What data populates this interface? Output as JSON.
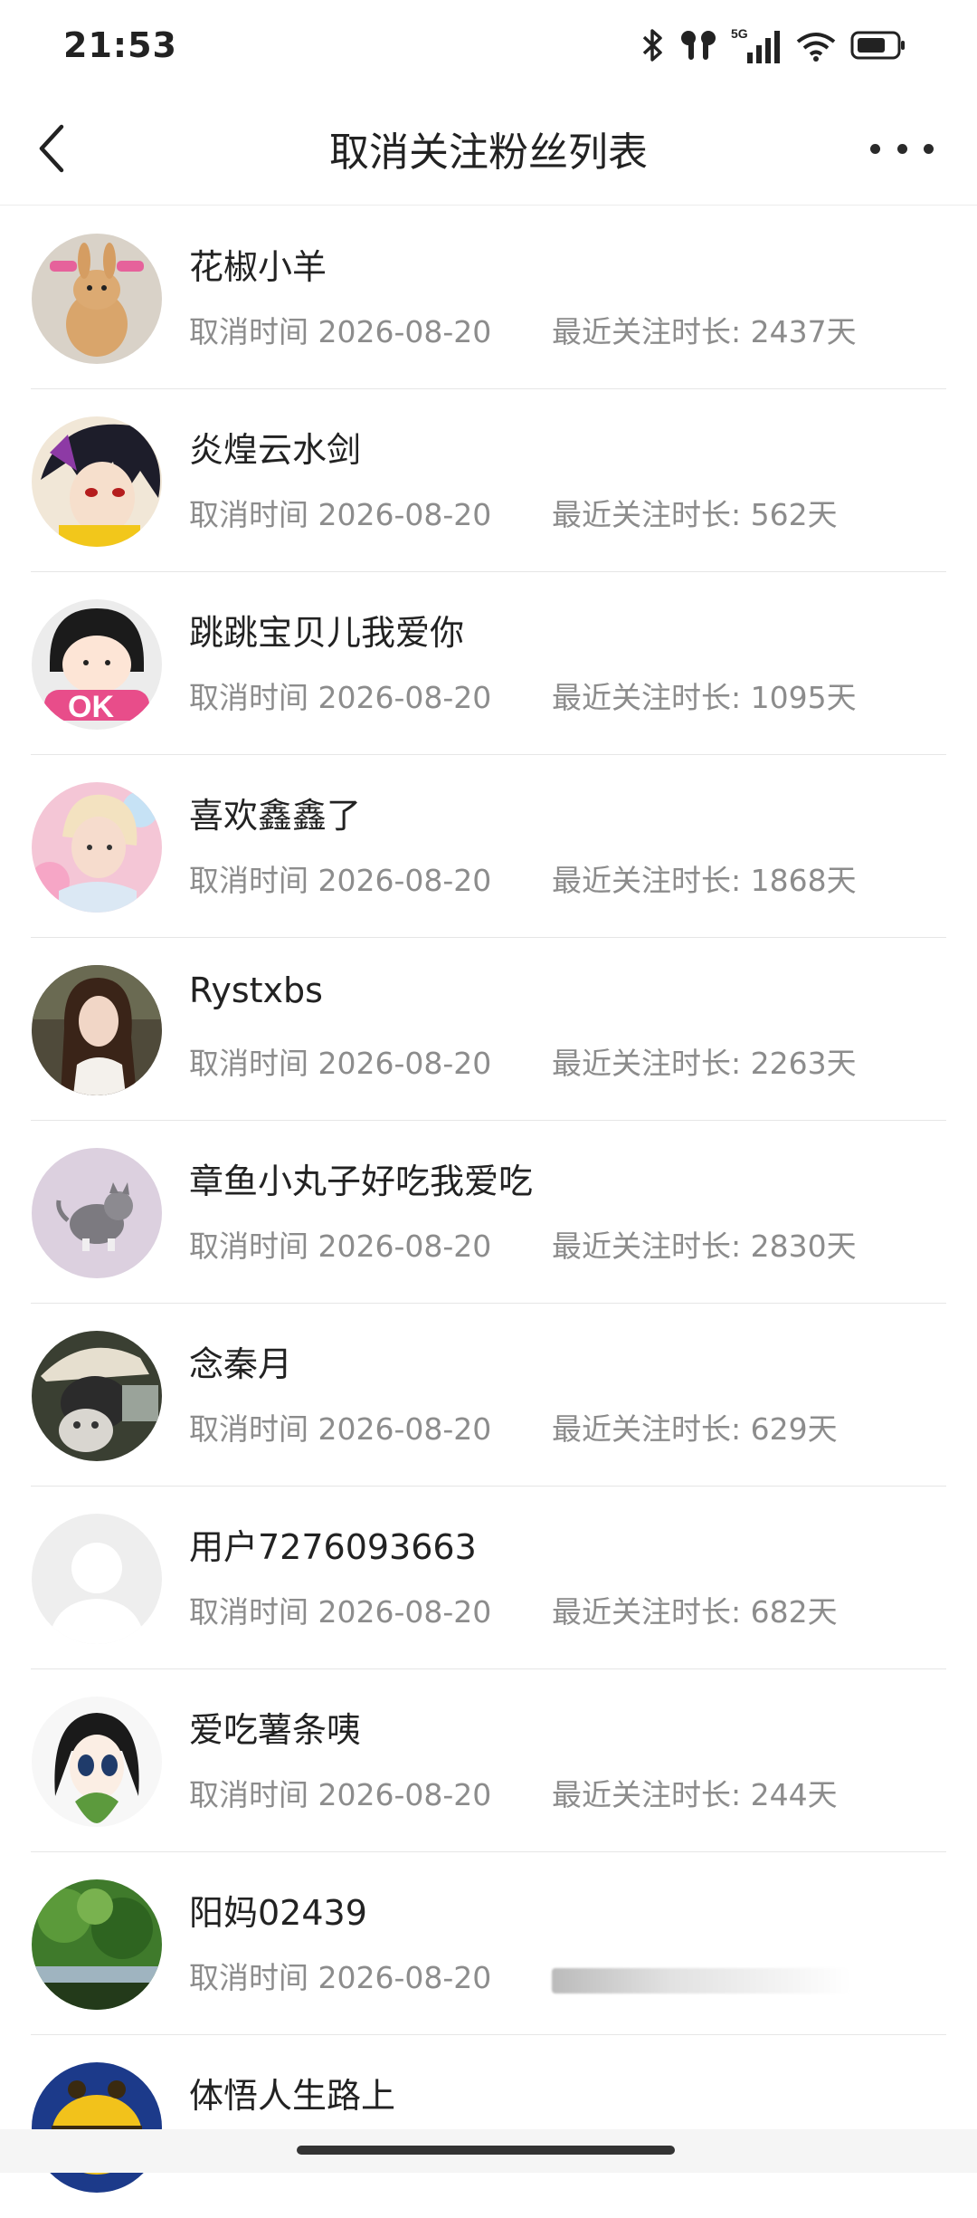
{
  "status_bar": {
    "time": "21:53",
    "icons": [
      "bluetooth-icon",
      "earbuds-icon",
      "signal-5g-icon",
      "wifi-icon",
      "battery-icon"
    ],
    "network_label": "5G"
  },
  "nav": {
    "title": "取消关注粉丝列表",
    "back_icon": "chevron-left-icon",
    "more_icon": "more-dots-icon"
  },
  "rows": [
    {
      "name": "花椒小羊",
      "cancel": "取消时间 2026-08-20",
      "duration": "最近关注时长: 2437天",
      "avatar": "rabbit-avatar"
    },
    {
      "name": "炎煌云水剑",
      "cancel": "取消时间 2026-08-20",
      "duration": "最近关注时长: 562天",
      "avatar": "anime-avatar"
    },
    {
      "name": "跳跳宝贝儿我爱你",
      "cancel": "取消时间 2026-08-20",
      "duration": "最近关注时长: 1095天",
      "avatar": "ok-girl-avatar"
    },
    {
      "name": "喜欢鑫鑫了",
      "cancel": "取消时间 2026-08-20",
      "duration": "最近关注时长: 1868天",
      "avatar": "idol-avatar"
    },
    {
      "name": "Rystxbs",
      "cancel": "取消时间 2026-08-20",
      "duration": "最近关注时长: 2263天",
      "avatar": "woman-avatar"
    },
    {
      "name": "章鱼小丸子好吃我爱吃",
      "cancel": "取消时间 2026-08-20",
      "duration": "最近关注时长: 2830天",
      "avatar": "kitten-avatar"
    },
    {
      "name": "念秦月",
      "cancel": "取消时间 2026-08-20",
      "duration": "最近关注时长: 629天",
      "avatar": "cat-hat-avatar"
    },
    {
      "name": "用户7276093663",
      "cancel": "取消时间 2026-08-20",
      "duration": "最近关注时长: 682天",
      "avatar": "default-user-avatar"
    },
    {
      "name": "爱吃薯条咦",
      "cancel": "取消时间 2026-08-20",
      "duration": "最近关注时长: 244天",
      "avatar": "cartoon-girl-avatar"
    },
    {
      "name": "阳妈02439",
      "cancel": "取消时间 2026-08-20",
      "duration": "",
      "avatar": "green-blur-avatar"
    },
    {
      "name": "体悟人生路上",
      "cancel": "",
      "duration": "",
      "avatar": "bee-avatar"
    }
  ]
}
